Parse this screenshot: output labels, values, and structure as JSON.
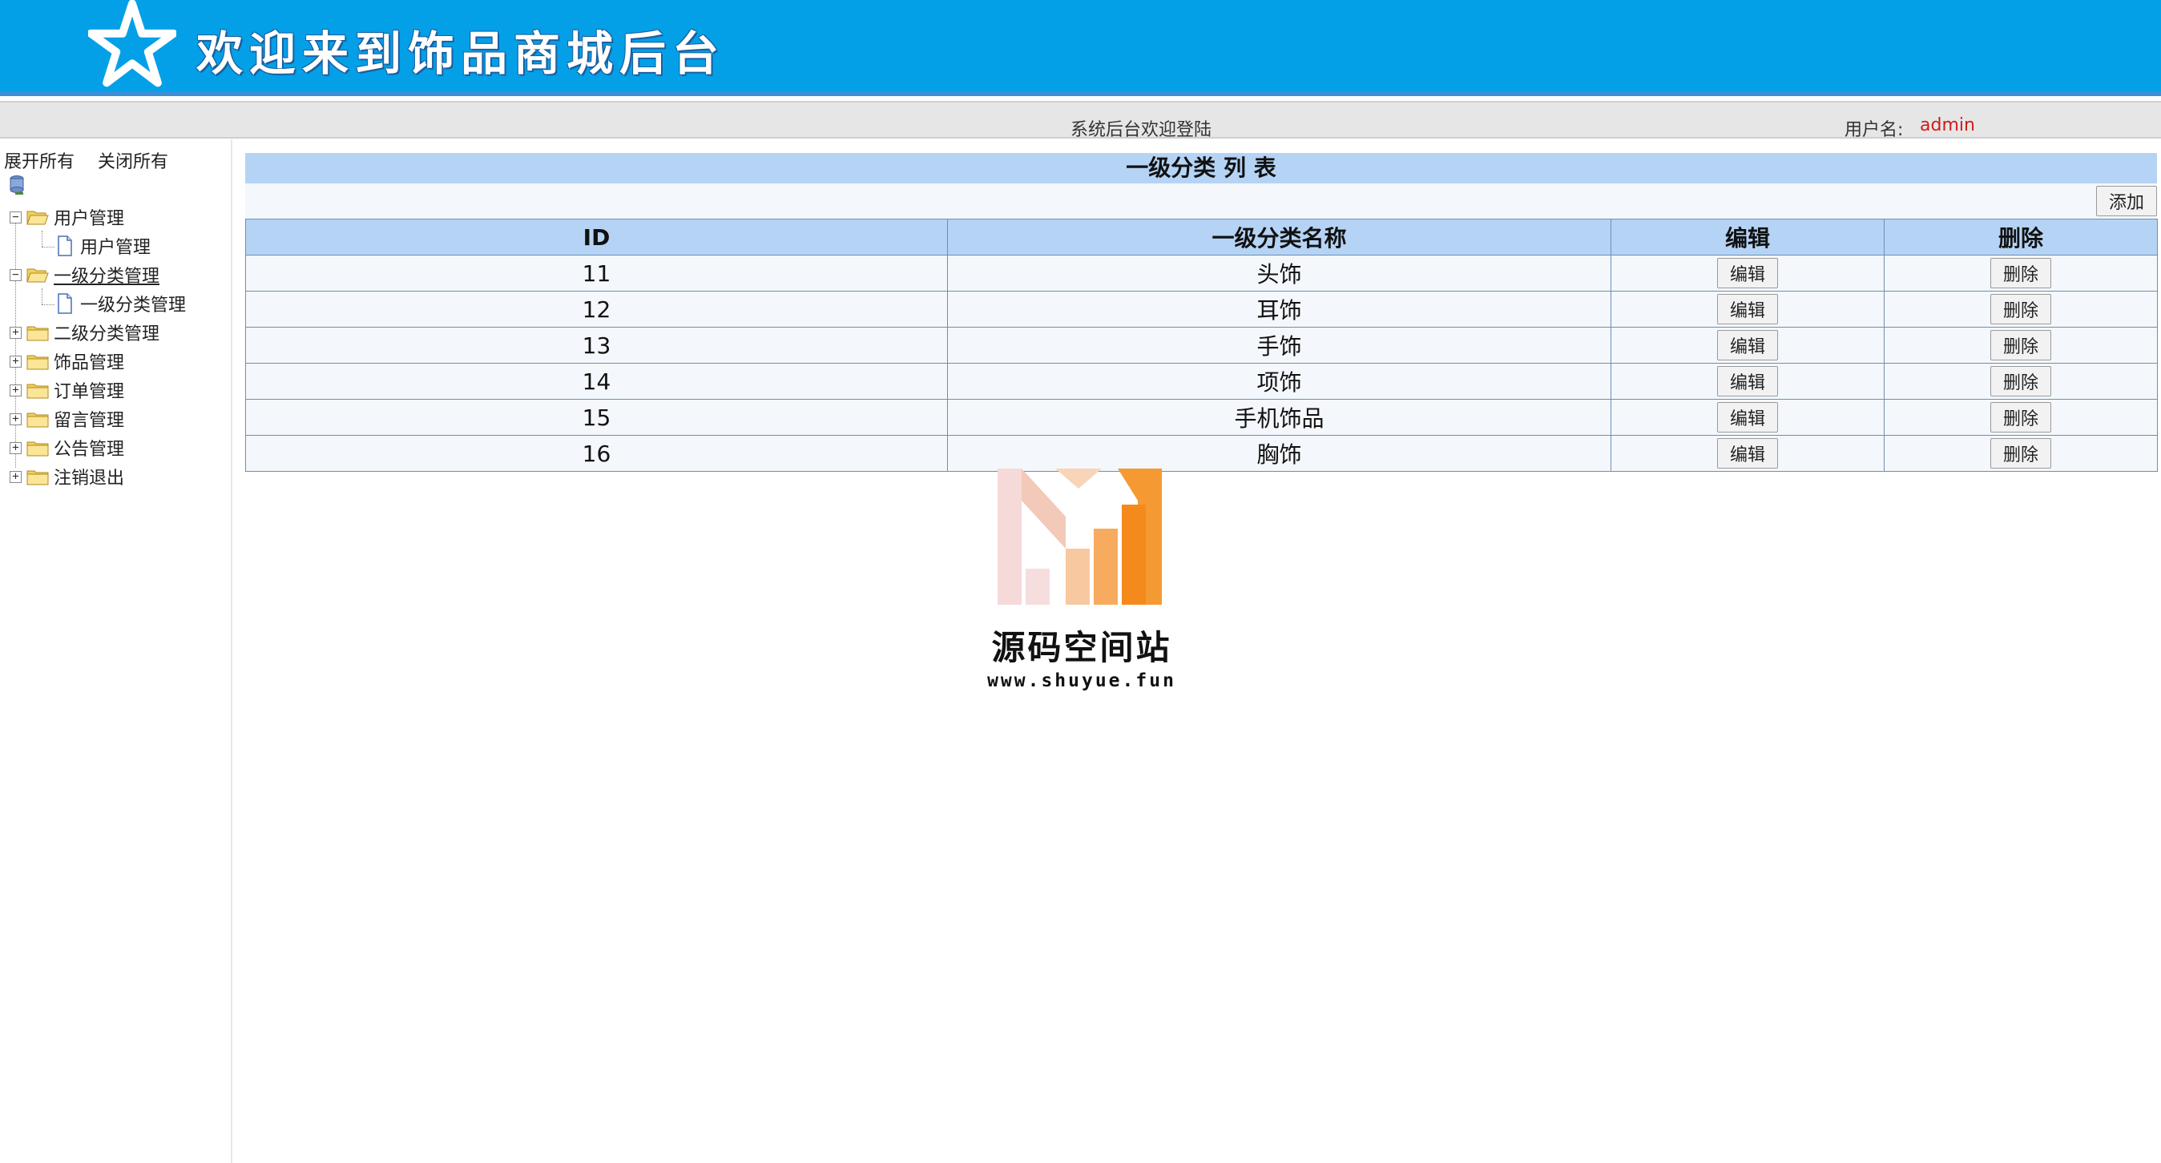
{
  "header": {
    "title": "欢迎来到饰品商城后台",
    "logo_icon": "star-icon"
  },
  "statusbar": {
    "welcome": "系统后台欢迎登陆",
    "user_label": "用户名:",
    "user_name": "admin"
  },
  "sidebar": {
    "expand_all": "展开所有",
    "collapse_all": "关闭所有",
    "items": [
      {
        "label": "用户管理",
        "expanded": true,
        "children": [
          {
            "label": "用户管理"
          }
        ]
      },
      {
        "label": "一级分类管理",
        "expanded": true,
        "active": true,
        "children": [
          {
            "label": "一级分类管理"
          }
        ]
      },
      {
        "label": "二级分类管理",
        "expanded": false
      },
      {
        "label": "饰品管理",
        "expanded": false
      },
      {
        "label": "订单管理",
        "expanded": false
      },
      {
        "label": "留言管理",
        "expanded": false
      },
      {
        "label": "公告管理",
        "expanded": false
      },
      {
        "label": "注销退出",
        "expanded": false
      }
    ]
  },
  "main": {
    "caption": "一级分类 列 表",
    "add_label": "添加",
    "columns": [
      "ID",
      "一级分类名称",
      "编辑",
      "删除"
    ],
    "edit_label": "编辑",
    "delete_label": "删除",
    "rows": [
      {
        "id": "11",
        "name": "头饰"
      },
      {
        "id": "12",
        "name": "耳饰"
      },
      {
        "id": "13",
        "name": "手饰"
      },
      {
        "id": "14",
        "name": "项饰"
      },
      {
        "id": "15",
        "name": "手机饰品"
      },
      {
        "id": "16",
        "name": "胸饰"
      }
    ]
  },
  "watermark": {
    "title": "源码空间站",
    "url": "www.shuyue.fun"
  },
  "colors": {
    "banner": "#03a0e8",
    "header_cell": "#b5d4f5",
    "row_bg": "#f4f7fb",
    "username": "#d11a1a"
  }
}
